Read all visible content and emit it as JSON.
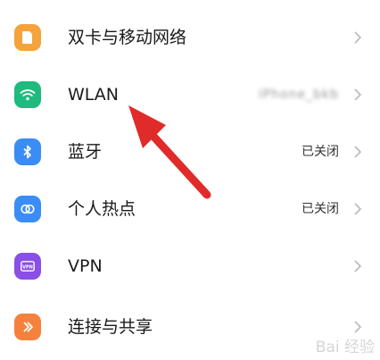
{
  "settings": {
    "items": [
      {
        "label": "双卡与移动网络",
        "status": "",
        "icon": "sim-card-icon",
        "color": "#f5a33c"
      },
      {
        "label": "WLAN",
        "status": "iPhone_bkb",
        "icon": "wifi-icon",
        "color": "#1fba7e"
      },
      {
        "label": "蓝牙",
        "status": "已关闭",
        "icon": "bluetooth-icon",
        "color": "#3b8cf5"
      },
      {
        "label": "个人热点",
        "status": "已关闭",
        "icon": "hotspot-icon",
        "color": "#3b8cf5"
      },
      {
        "label": "VPN",
        "status": "",
        "icon": "vpn-icon",
        "color": "#8a4fe6"
      },
      {
        "label": "连接与共享",
        "status": "",
        "icon": "share-icon",
        "color": "#f5823c"
      }
    ]
  },
  "watermark": {
    "text": "Bai 经验"
  },
  "colors": {
    "annotation_arrow": "#e02b2b",
    "chevron": "#b9b9b9"
  }
}
